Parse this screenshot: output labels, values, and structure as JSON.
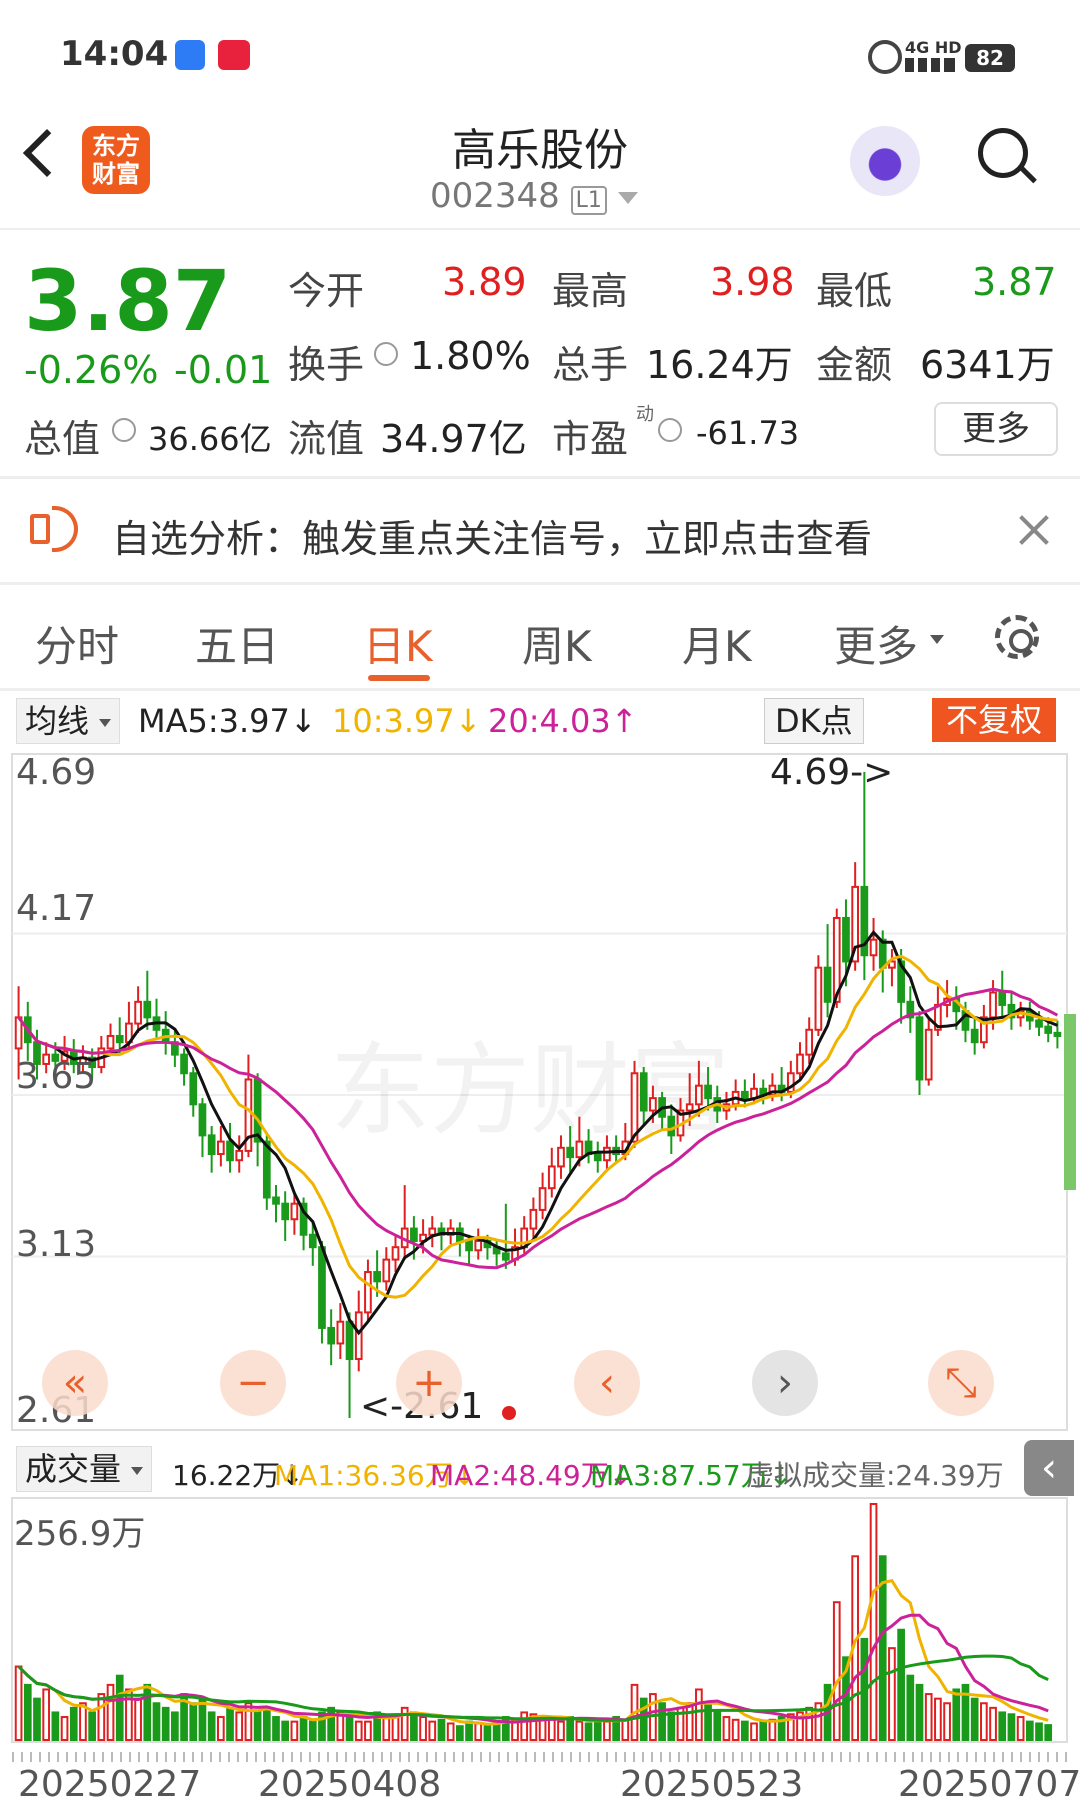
{
  "status_bar": {
    "time": "14:04",
    "network": "4G HD",
    "battery": "82"
  },
  "header": {
    "logo_line1": "东方",
    "logo_line2": "财富",
    "title": "高乐股份",
    "code": "002348",
    "level": "L1"
  },
  "quote": {
    "price": "3.87",
    "change_pct": "-0.26%",
    "change": "-0.01",
    "open_label": "今开",
    "open": "3.89",
    "high_label": "最高",
    "high": "3.98",
    "low_label": "最低",
    "low": "3.87",
    "turnover_label": "换手",
    "turnover": "1.80%",
    "volume_label": "总手",
    "volume": "16.24万",
    "amount_label": "金额",
    "amount": "6341万",
    "mcap_label": "总值",
    "mcap": "36.66亿",
    "float_label": "流值",
    "float": "34.97亿",
    "pe_label": "市盈",
    "pe_sup": "动",
    "pe": "-61.73",
    "more": "更多"
  },
  "banner": {
    "text": "自选分析：触发重点关注信号，立即点击查看"
  },
  "tabs": [
    {
      "label": "分时"
    },
    {
      "label": "五日"
    },
    {
      "label": "日K"
    },
    {
      "label": "周K"
    },
    {
      "label": "月K"
    },
    {
      "label": "更多"
    }
  ],
  "ma_bar": {
    "select": "均线",
    "ma5": "MA5:3.97",
    "ma10": "10:3.97",
    "ma20": "20:4.03",
    "dk": "DK点",
    "adjust": "不复权"
  },
  "kchart": {
    "y_labels": [
      "4.69",
      "4.17",
      "3.65",
      "3.13",
      "2.61"
    ],
    "high_note": "4.69->",
    "low_note": "<-2.61",
    "watermark": "东方财富"
  },
  "volume_bar": {
    "select": "成交量",
    "vol": "16.22万",
    "ma1": "MA1:36.36万",
    "ma2": "MA2:48.49万",
    "ma3": "MA3:87.57万",
    "virtual": "虚拟成交量:24.39万",
    "max_label": "256.9万"
  },
  "dates": [
    "20250227",
    "20250408",
    "20250523",
    "20250707"
  ],
  "colors": {
    "up": "#e02020",
    "down": "#1a9a1a",
    "ma5": "#111111",
    "ma10": "#f0b400",
    "ma20": "#cc2299",
    "accent": "#e8602c"
  },
  "chart_data": {
    "type": "candlestick",
    "title": "日K",
    "ylim": [
      2.61,
      4.69
    ],
    "candles": [
      [
        3.8,
        3.9,
        3.7,
        4.0
      ],
      [
        3.9,
        3.82,
        3.76,
        3.95
      ],
      [
        3.82,
        3.75,
        3.7,
        3.86
      ],
      [
        3.75,
        3.78,
        3.72,
        3.82
      ],
      [
        3.78,
        3.76,
        3.72,
        3.82
      ],
      [
        3.76,
        3.79,
        3.73,
        3.84
      ],
      [
        3.79,
        3.75,
        3.72,
        3.83
      ],
      [
        3.75,
        3.77,
        3.72,
        3.81
      ],
      [
        3.77,
        3.74,
        3.7,
        3.8
      ],
      [
        3.74,
        3.8,
        3.72,
        3.84
      ],
      [
        3.8,
        3.84,
        3.78,
        3.88
      ],
      [
        3.84,
        3.82,
        3.78,
        3.9
      ],
      [
        3.82,
        3.88,
        3.8,
        3.95
      ],
      [
        3.88,
        3.95,
        3.85,
        4.0
      ],
      [
        3.95,
        3.9,
        3.86,
        4.05
      ],
      [
        3.9,
        3.86,
        3.83,
        3.96
      ],
      [
        3.86,
        3.82,
        3.78,
        3.92
      ],
      [
        3.82,
        3.78,
        3.74,
        3.86
      ],
      [
        3.78,
        3.72,
        3.68,
        3.8
      ],
      [
        3.72,
        3.62,
        3.58,
        3.74
      ],
      [
        3.62,
        3.52,
        3.45,
        3.64
      ],
      [
        3.52,
        3.46,
        3.4,
        3.55
      ],
      [
        3.46,
        3.5,
        3.42,
        3.55
      ],
      [
        3.5,
        3.44,
        3.4,
        3.56
      ],
      [
        3.44,
        3.47,
        3.4,
        3.52
      ],
      [
        3.47,
        3.7,
        3.45,
        3.78
      ],
      [
        3.7,
        3.5,
        3.42,
        3.72
      ],
      [
        3.5,
        3.32,
        3.28,
        3.52
      ],
      [
        3.32,
        3.3,
        3.24,
        3.36
      ],
      [
        3.3,
        3.25,
        3.18,
        3.34
      ],
      [
        3.25,
        3.3,
        3.2,
        3.33
      ],
      [
        3.3,
        3.2,
        3.15,
        3.32
      ],
      [
        3.2,
        3.16,
        3.1,
        3.24
      ],
      [
        3.16,
        2.9,
        2.85,
        3.18
      ],
      [
        2.9,
        2.85,
        2.78,
        2.96
      ],
      [
        2.85,
        2.92,
        2.8,
        2.98
      ],
      [
        2.92,
        2.8,
        2.61,
        2.95
      ],
      [
        2.8,
        2.95,
        2.76,
        3.02
      ],
      [
        2.95,
        3.08,
        2.92,
        3.12
      ],
      [
        3.08,
        3.05,
        3.0,
        3.15
      ],
      [
        3.05,
        3.12,
        3.02,
        3.16
      ],
      [
        3.12,
        3.16,
        3.08,
        3.2
      ],
      [
        3.16,
        3.22,
        3.12,
        3.36
      ],
      [
        3.22,
        3.18,
        3.12,
        3.26
      ],
      [
        3.18,
        3.2,
        3.14,
        3.25
      ],
      [
        3.2,
        3.22,
        3.16,
        3.26
      ],
      [
        3.22,
        3.2,
        3.15,
        3.24
      ],
      [
        3.2,
        3.22,
        3.17,
        3.25
      ],
      [
        3.22,
        3.18,
        3.13,
        3.24
      ],
      [
        3.18,
        3.15,
        3.1,
        3.2
      ],
      [
        3.15,
        3.18,
        3.12,
        3.22
      ],
      [
        3.18,
        3.16,
        3.12,
        3.2
      ],
      [
        3.16,
        3.14,
        3.1,
        3.18
      ],
      [
        3.14,
        3.12,
        3.09,
        3.3
      ],
      [
        3.12,
        3.16,
        3.1,
        3.22
      ],
      [
        3.16,
        3.22,
        3.14,
        3.26
      ],
      [
        3.22,
        3.28,
        3.18,
        3.32
      ],
      [
        3.28,
        3.35,
        3.25,
        3.4
      ],
      [
        3.35,
        3.42,
        3.32,
        3.48
      ],
      [
        3.42,
        3.48,
        3.38,
        3.52
      ],
      [
        3.48,
        3.45,
        3.4,
        3.55
      ],
      [
        3.45,
        3.5,
        3.42,
        3.58
      ],
      [
        3.5,
        3.46,
        3.43,
        3.54
      ],
      [
        3.46,
        3.44,
        3.4,
        3.5
      ],
      [
        3.44,
        3.48,
        3.41,
        3.52
      ],
      [
        3.48,
        3.46,
        3.43,
        3.52
      ],
      [
        3.46,
        3.5,
        3.44,
        3.56
      ],
      [
        3.5,
        3.72,
        3.48,
        3.76
      ],
      [
        3.72,
        3.6,
        3.55,
        3.74
      ],
      [
        3.6,
        3.64,
        3.56,
        3.68
      ],
      [
        3.64,
        3.58,
        3.54,
        3.66
      ],
      [
        3.58,
        3.52,
        3.46,
        3.62
      ],
      [
        3.52,
        3.6,
        3.5,
        3.64
      ],
      [
        3.6,
        3.62,
        3.55,
        3.72
      ],
      [
        3.62,
        3.68,
        3.58,
        3.76
      ],
      [
        3.68,
        3.64,
        3.6,
        3.74
      ],
      [
        3.64,
        3.6,
        3.56,
        3.68
      ],
      [
        3.6,
        3.62,
        3.57,
        3.66
      ],
      [
        3.62,
        3.66,
        3.6,
        3.7
      ],
      [
        3.66,
        3.64,
        3.61,
        3.7
      ],
      [
        3.64,
        3.67,
        3.62,
        3.72
      ],
      [
        3.67,
        3.65,
        3.62,
        3.7
      ],
      [
        3.65,
        3.68,
        3.63,
        3.72
      ],
      [
        3.68,
        3.66,
        3.63,
        3.74
      ],
      [
        3.66,
        3.72,
        3.64,
        3.76
      ],
      [
        3.72,
        3.78,
        3.7,
        3.82
      ],
      [
        3.78,
        3.86,
        3.75,
        3.9
      ],
      [
        3.86,
        4.06,
        3.84,
        4.1
      ],
      [
        4.06,
        3.95,
        3.9,
        4.2
      ],
      [
        3.95,
        4.22,
        3.93,
        4.25
      ],
      [
        4.22,
        4.08,
        4.0,
        4.28
      ],
      [
        4.08,
        4.32,
        4.05,
        4.4
      ],
      [
        4.32,
        4.1,
        4.02,
        4.69
      ],
      [
        4.1,
        4.15,
        4.05,
        4.22
      ],
      [
        4.15,
        4.06,
        3.98,
        4.18
      ],
      [
        4.06,
        4.08,
        4.0,
        4.12
      ],
      [
        4.08,
        3.95,
        3.88,
        4.12
      ],
      [
        3.95,
        3.9,
        3.85,
        4.0
      ],
      [
        3.9,
        3.7,
        3.65,
        3.92
      ],
      [
        3.7,
        3.86,
        3.68,
        3.9
      ],
      [
        3.86,
        3.94,
        3.84,
        4.0
      ],
      [
        3.94,
        3.96,
        3.9,
        4.02
      ],
      [
        3.96,
        3.92,
        3.86,
        4.0
      ],
      [
        3.92,
        3.86,
        3.82,
        3.95
      ],
      [
        3.86,
        3.82,
        3.78,
        3.9
      ],
      [
        3.82,
        3.9,
        3.8,
        3.94
      ],
      [
        3.9,
        3.98,
        3.86,
        4.02
      ],
      [
        3.98,
        3.94,
        3.9,
        4.05
      ],
      [
        3.94,
        3.9,
        3.86,
        3.98
      ],
      [
        3.9,
        3.92,
        3.87,
        3.95
      ],
      [
        3.92,
        3.89,
        3.86,
        3.95
      ],
      [
        3.89,
        3.87,
        3.84,
        3.92
      ],
      [
        3.87,
        3.85,
        3.82,
        3.9
      ],
      [
        3.85,
        3.84,
        3.8,
        3.89
      ]
    ],
    "volume": {
      "max": 256.9,
      "values": [
        80,
        60,
        45,
        55,
        30,
        25,
        35,
        40,
        30,
        50,
        60,
        70,
        55,
        45,
        60,
        40,
        35,
        30,
        50,
        40,
        45,
        30,
        25,
        35,
        30,
        40,
        30,
        35,
        25,
        20,
        20,
        25,
        20,
        30,
        35,
        30,
        25,
        20,
        20,
        30,
        25,
        28,
        35,
        30,
        25,
        20,
        22,
        18,
        15,
        20,
        18,
        15,
        20,
        25,
        22,
        30,
        28,
        25,
        22,
        20,
        25,
        20,
        18,
        22,
        20,
        25,
        22,
        60,
        45,
        50,
        40,
        30,
        35,
        40,
        55,
        40,
        30,
        25,
        22,
        20,
        18,
        20,
        22,
        25,
        28,
        30,
        35,
        40,
        60,
        150,
        90,
        200,
        110,
        256.9,
        200,
        100,
        120,
        70,
        60,
        50,
        45,
        40,
        55,
        60,
        45,
        40,
        35,
        30,
        28,
        25,
        20,
        18,
        16.22
      ]
    }
  }
}
